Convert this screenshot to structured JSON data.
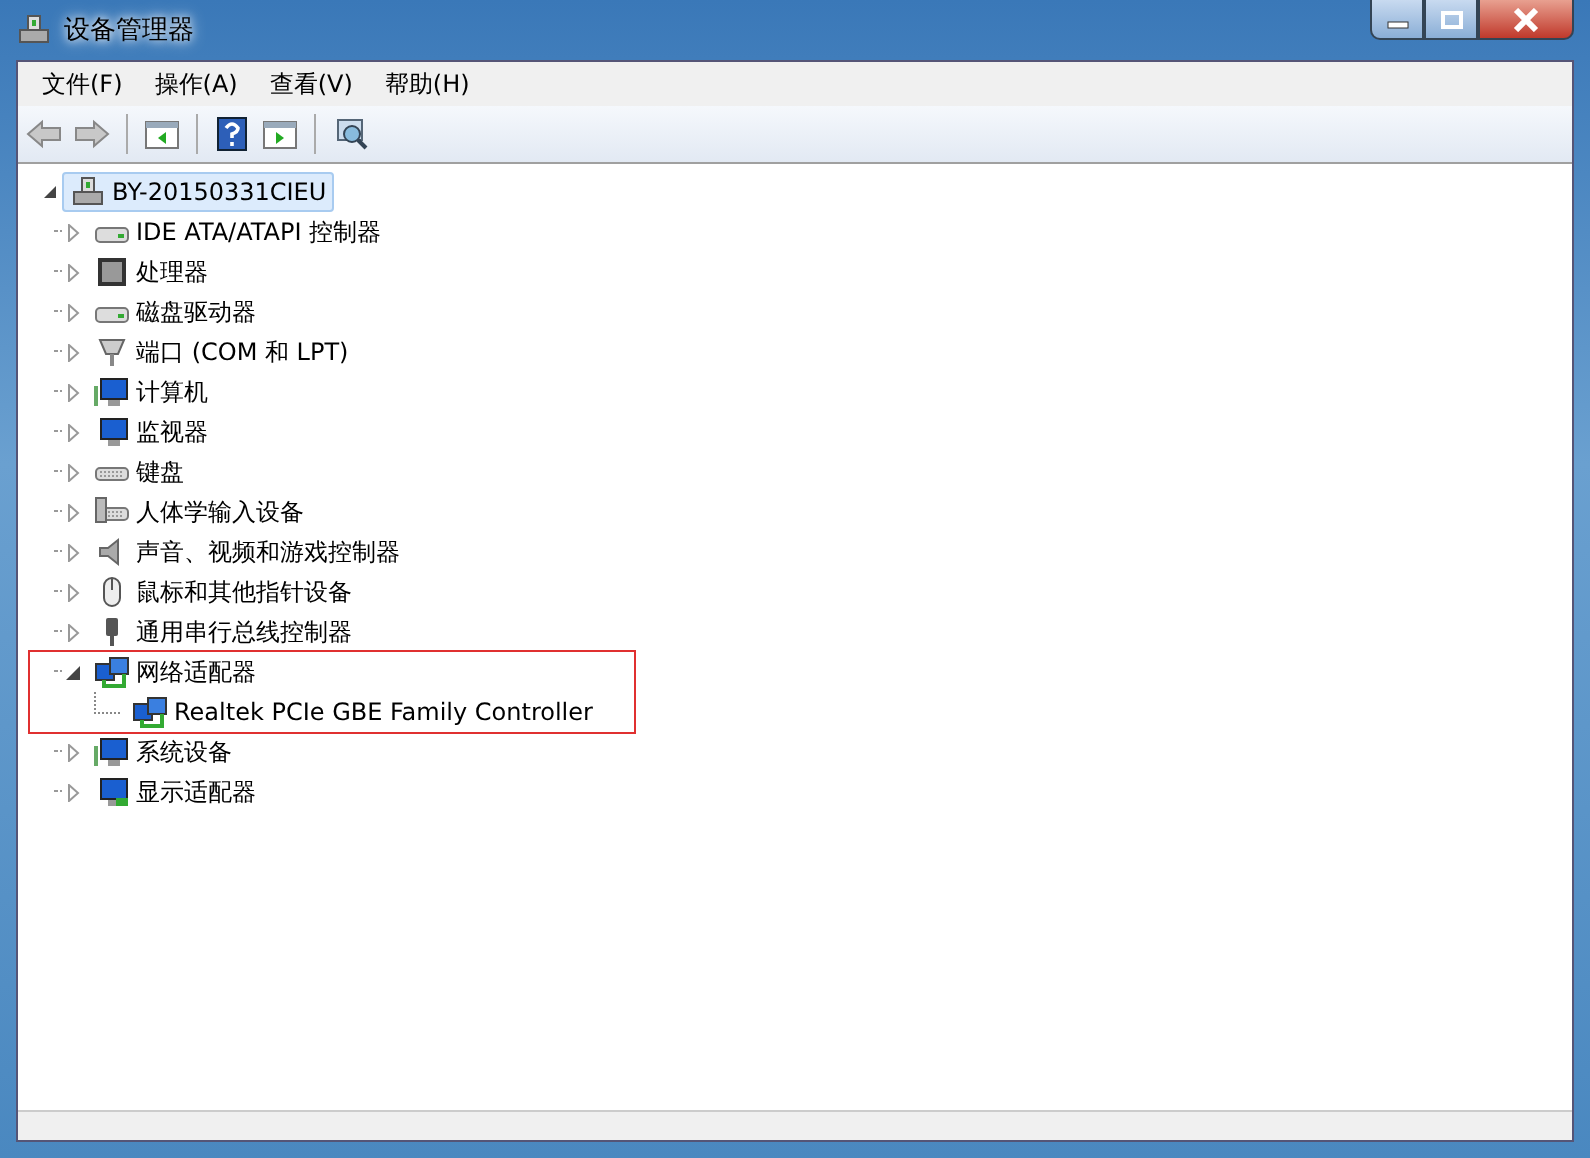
{
  "window": {
    "title": "设备管理器"
  },
  "menu": [
    "文件(F)",
    "操作(A)",
    "查看(V)",
    "帮助(H)"
  ],
  "toolbar": [
    {
      "kind": "back",
      "disabled": true
    },
    {
      "kind": "forward",
      "disabled": true
    },
    {
      "kind": "sep"
    },
    {
      "kind": "panel-left"
    },
    {
      "kind": "sep"
    },
    {
      "kind": "help"
    },
    {
      "kind": "panel-right"
    },
    {
      "kind": "sep"
    },
    {
      "kind": "scan"
    }
  ],
  "tree": {
    "label": "BY-20150331CIEU",
    "expanded": true,
    "selected": true,
    "children": [
      {
        "label": "IDE ATA/ATAPI 控制器",
        "kind": "drive",
        "expanded": false,
        "highlighted": false
      },
      {
        "label": "处理器",
        "kind": "chip",
        "expanded": false,
        "highlighted": false
      },
      {
        "label": "磁盘驱动器",
        "kind": "drive",
        "expanded": false,
        "highlighted": false
      },
      {
        "label": "端口 (COM 和 LPT)",
        "kind": "port",
        "expanded": false,
        "highlighted": false
      },
      {
        "label": "计算机",
        "kind": "computer",
        "expanded": false,
        "highlighted": false
      },
      {
        "label": "监视器",
        "kind": "monitor",
        "expanded": false,
        "highlighted": false
      },
      {
        "label": "键盘",
        "kind": "keyboard",
        "expanded": false,
        "highlighted": false
      },
      {
        "label": "人体学输入设备",
        "kind": "hid",
        "expanded": false,
        "highlighted": false
      },
      {
        "label": "声音、视频和游戏控制器",
        "kind": "speaker",
        "expanded": false,
        "highlighted": false
      },
      {
        "label": "鼠标和其他指针设备",
        "kind": "mouse",
        "expanded": false,
        "highlighted": false
      },
      {
        "label": "通用串行总线控制器",
        "kind": "usb",
        "expanded": false,
        "highlighted": false
      },
      {
        "label": "网络适配器",
        "kind": "network",
        "expanded": true,
        "highlighted": true,
        "children": [
          {
            "label": "Realtek PCIe GBE Family Controller",
            "kind": "network"
          }
        ]
      },
      {
        "label": "系统设备",
        "kind": "computer",
        "expanded": false,
        "highlighted": false
      },
      {
        "label": "显示适配器",
        "kind": "display",
        "expanded": false,
        "highlighted": false
      }
    ]
  }
}
